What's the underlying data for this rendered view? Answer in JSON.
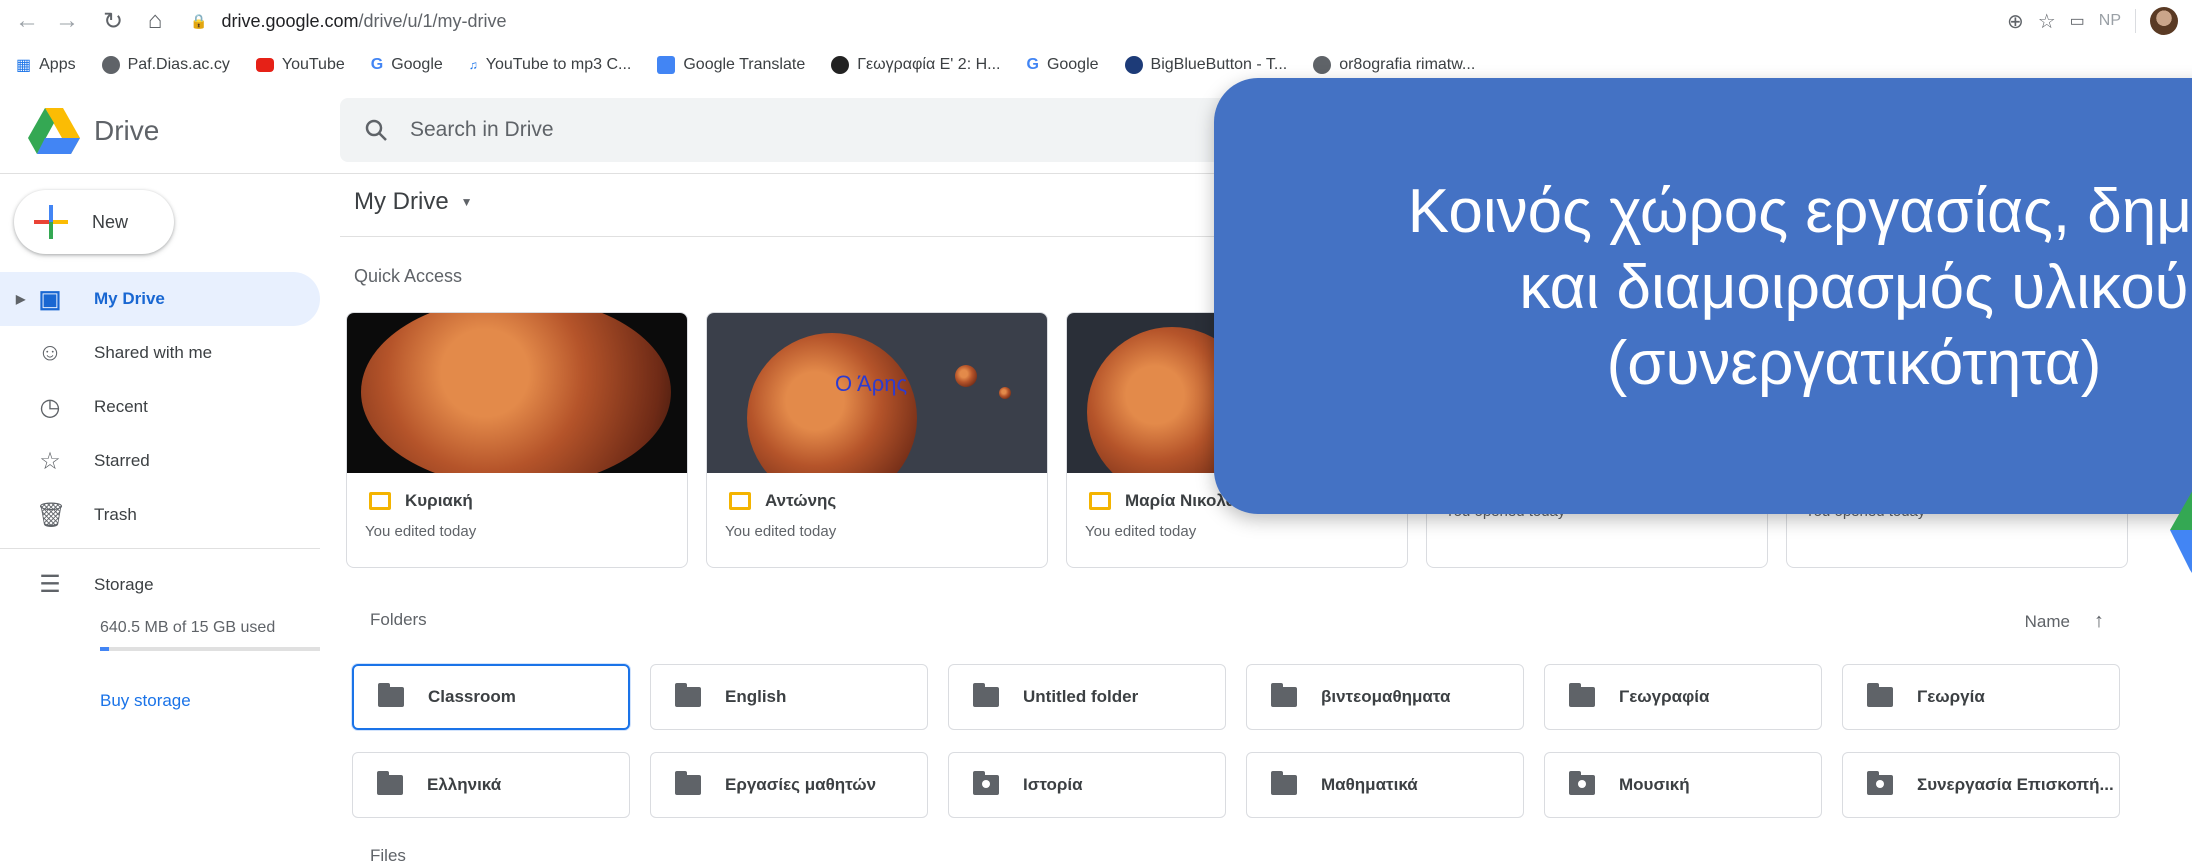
{
  "browser": {
    "url_host": "drive.google.com",
    "url_path": "/drive/u/1/my-drive",
    "profile_initials": "NP",
    "bookmarks": [
      {
        "label": "Apps"
      },
      {
        "label": "Paf.Dias.ac.cy"
      },
      {
        "label": "YouTube"
      },
      {
        "label": "Google"
      },
      {
        "label": "YouTube to mp3 C..."
      },
      {
        "label": "Google Translate"
      },
      {
        "label": "Γεωγραφία Ε' 2: Η..."
      },
      {
        "label": "Google"
      },
      {
        "label": "BigBlueButton - T..."
      },
      {
        "label": "or8ografia rimatw..."
      }
    ]
  },
  "header": {
    "app_name": "Drive",
    "search_placeholder": "Search in Drive"
  },
  "sidebar": {
    "new_label": "New",
    "items": [
      {
        "label": "My Drive",
        "icon": "drive-folder-icon"
      },
      {
        "label": "Shared with me",
        "icon": "people-icon"
      },
      {
        "label": "Recent",
        "icon": "clock-icon"
      },
      {
        "label": "Starred",
        "icon": "star-icon"
      },
      {
        "label": "Trash",
        "icon": "trash-icon"
      }
    ],
    "storage": {
      "label": "Storage",
      "used_text": "640.5 MB of 15 GB used",
      "used_fraction": 0.04,
      "buy_label": "Buy storage"
    }
  },
  "main": {
    "breadcrumb": "My Drive",
    "quick_access_title": "Quick Access",
    "quick_access": [
      {
        "title": "Κυριακή",
        "subtitle": "You edited today",
        "thumb_text": ""
      },
      {
        "title": "Αντώνης",
        "subtitle": "You edited today",
        "thumb_text": "Ο Άρης"
      },
      {
        "title": "Μαρία Νικολάο",
        "subtitle": "You edited today",
        "thumb_text": ""
      },
      {
        "title": "",
        "subtitle": "You opened today",
        "thumb_text": ""
      },
      {
        "title": "",
        "subtitle": "You opened today",
        "thumb_text": ""
      }
    ],
    "folders_title": "Folders",
    "sort_label": "Name",
    "folders": [
      {
        "name": "Classroom",
        "shared": false
      },
      {
        "name": "English",
        "shared": false
      },
      {
        "name": "Untitled folder",
        "shared": false
      },
      {
        "name": "βιντεομαθηματα",
        "shared": false
      },
      {
        "name": "Γεωγραφία",
        "shared": false
      },
      {
        "name": "Γεωργία",
        "shared": false
      },
      {
        "name": "Ελληνικά",
        "shared": false
      },
      {
        "name": "Εργασίες μαθητών",
        "shared": false
      },
      {
        "name": "Ιστορία",
        "shared": true
      },
      {
        "name": "Μαθηματικά",
        "shared": false
      },
      {
        "name": "Μουσική",
        "shared": true
      },
      {
        "name": "Συνεργασία Επισκοπή...",
        "shared": true
      }
    ],
    "files_title": "Files"
  },
  "overlay": {
    "lines": [
      "Κοινός χώρος εργασίας, δημιο",
      "και διαμοιρασμός υλικού",
      "(συνεργατικότητα)"
    ],
    "color": "#4472c4"
  }
}
